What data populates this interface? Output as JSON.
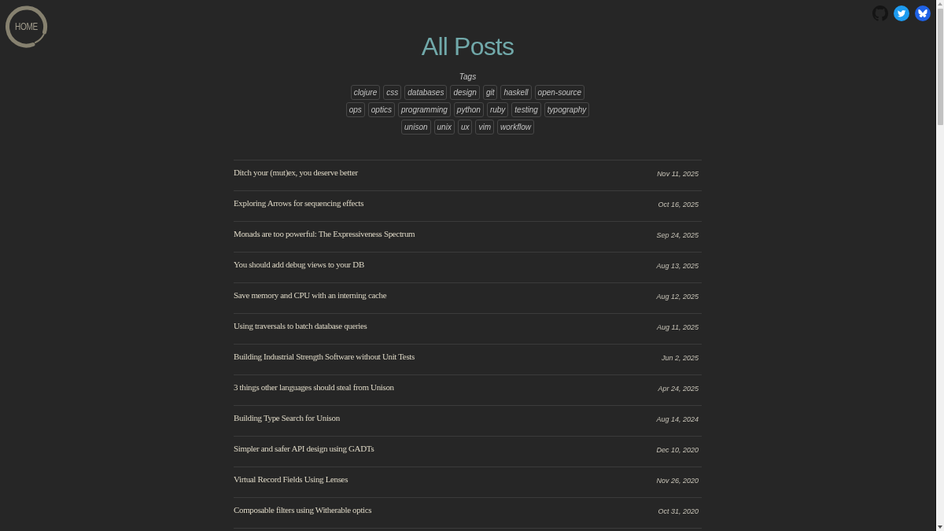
{
  "home_link": {
    "label": "HOME"
  },
  "title": "All Posts",
  "tags": {
    "heading": "Tags",
    "items": [
      "clojure",
      "css",
      "databases",
      "design",
      "git",
      "haskell",
      "open-source",
      "ops",
      "optics",
      "programming",
      "python",
      "ruby",
      "testing",
      "typography",
      "unison",
      "unix",
      "ux",
      "vim",
      "workflow"
    ]
  },
  "posts": [
    {
      "title": "Ditch your (mut)ex, you deserve better",
      "date": "Nov 11, 2025"
    },
    {
      "title": "Exploring Arrows for sequencing effects",
      "date": "Oct 16, 2025"
    },
    {
      "title": "Monads are too powerful: The Expressiveness Spectrum",
      "date": "Sep 24, 2025"
    },
    {
      "title": "You should add debug views to your DB",
      "date": "Aug 13, 2025"
    },
    {
      "title": "Save memory and CPU with an interning cache",
      "date": "Aug 12, 2025"
    },
    {
      "title": "Using traversals to batch database queries",
      "date": "Aug 11, 2025"
    },
    {
      "title": "Building Industrial Strength Software without Unit Tests",
      "date": "Jun 2, 2025"
    },
    {
      "title": "3 things other languages should steal from Unison",
      "date": "Apr 24, 2025"
    },
    {
      "title": "Building Type Search for Unison",
      "date": "Aug 14, 2024"
    },
    {
      "title": "Simpler and safer API design using GADTs",
      "date": "Dec 10, 2020"
    },
    {
      "title": "Virtual Record Fields Using Lenses",
      "date": "Nov 26, 2020"
    },
    {
      "title": "Composable filters using Witherable optics",
      "date": "Oct 31, 2020"
    }
  ]
}
